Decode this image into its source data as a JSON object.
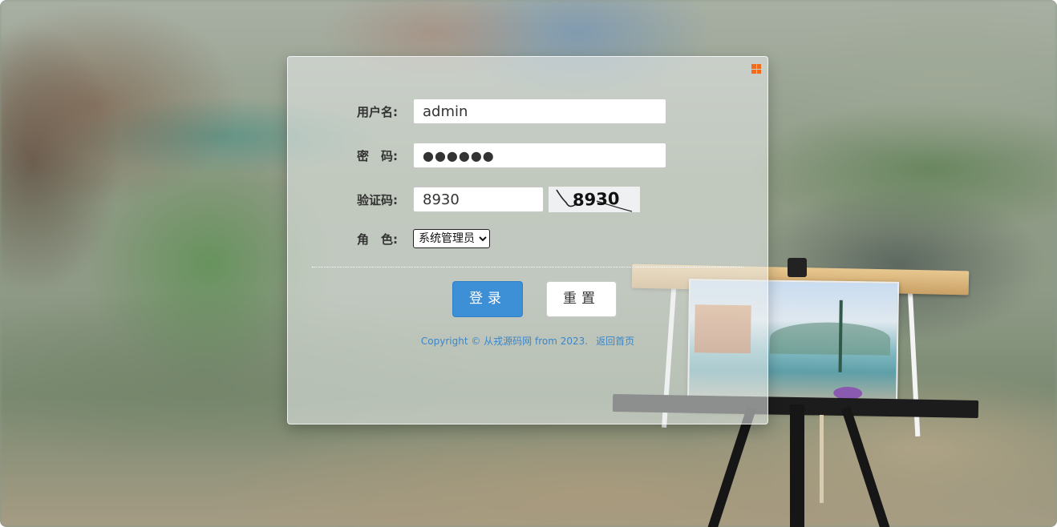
{
  "login_form": {
    "username_label": "用户名:",
    "username_value": "admin",
    "password_label": "密　码:",
    "password_value": "●●●●●●",
    "captcha_label": "验证码:",
    "captcha_value": "8930",
    "captcha_image_text": "8930",
    "role_label": "角　色:",
    "role_selected": "系统管理员",
    "login_button": "登录",
    "reset_button": "重置",
    "copyright_text": "Copyright © 从戎源码网 from 2023.",
    "back_home_link": "返回首页"
  },
  "colors": {
    "accent_blue": "#3d8fd6",
    "corner_icon_orange": "#f26b1d",
    "link_blue": "#3a86c8"
  },
  "icons": {
    "corner": "windows-grid-icon"
  }
}
